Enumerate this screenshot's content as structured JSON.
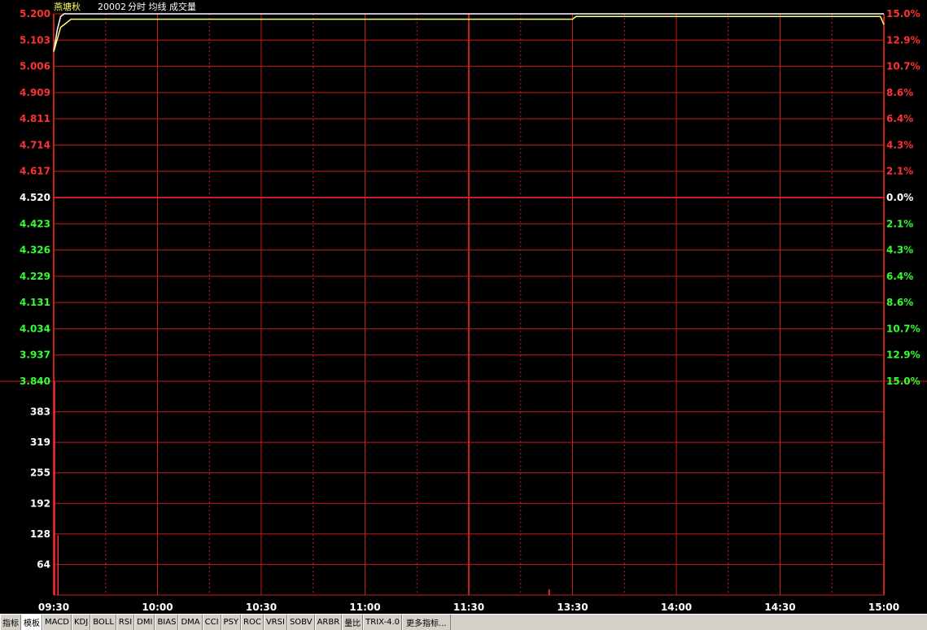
{
  "header": {
    "stock_name": "燕塘秋",
    "code": "20002",
    "legend": "分时 均线 成交量"
  },
  "chart_data": [
    {
      "type": "line",
      "title": "",
      "y_ticks_left": [
        "5.200",
        "5.103",
        "5.006",
        "4.909",
        "4.811",
        "4.714",
        "4.617",
        "4.520",
        "4.423",
        "4.326",
        "4.229",
        "4.131",
        "4.034",
        "3.937",
        "3.840"
      ],
      "y_ticks_right": [
        "15.0%",
        "12.9%",
        "10.7%",
        "8.6%",
        "6.4%",
        "4.3%",
        "2.1%",
        "0.0%",
        "2.1%",
        "4.3%",
        "6.4%",
        "8.6%",
        "10.7%",
        "12.9%",
        "15.0%"
      ],
      "ylim": [
        3.84,
        5.2
      ],
      "prev_close": 4.52,
      "x_ticks": [
        "09:30",
        "10:00",
        "10:30",
        "11:00",
        "11:30",
        "13:30",
        "14:00",
        "14:30",
        "15:00"
      ],
      "series": [
        {
          "name": "分时",
          "color": "#ffffff",
          "points": [
            [
              0,
              5.06
            ],
            [
              1,
              5.14
            ],
            [
              2,
              5.19
            ],
            [
              3,
              5.2
            ],
            [
              240,
              5.2
            ]
          ]
        },
        {
          "name": "均线",
          "color": "#ffff66",
          "points": [
            [
              0,
              5.06
            ],
            [
              2,
              5.15
            ],
            [
              5,
              5.18
            ],
            [
              150,
              5.18
            ],
            [
              151,
              5.19
            ],
            [
              239,
              5.19
            ],
            [
              240,
              5.16
            ]
          ]
        }
      ]
    },
    {
      "type": "bar",
      "y_ticks": [
        "383",
        "319",
        "255",
        "192",
        "128",
        "64"
      ],
      "ylim": [
        0,
        447
      ],
      "bars": [
        {
          "minute": 0,
          "volume": 447
        },
        {
          "minute": 1,
          "volume": 125
        },
        {
          "minute": 143,
          "volume": 12
        }
      ]
    }
  ],
  "colors": {
    "grid": "#c81e1e",
    "up": "#ff3232",
    "down": "#32ff32",
    "flat": "#ffffff",
    "volume": "#ff3232"
  },
  "toolbar": {
    "items": [
      "指标",
      "模板",
      "MACD",
      "KDJ",
      "BOLL",
      "RSI",
      "DMI",
      "BIAS",
      "DMA",
      "CCI",
      "PSY",
      "ROC",
      "VRSI",
      "SOBV",
      "ARBR",
      "量比",
      "TRIX-4.0",
      "更多指标..."
    ],
    "active": "模板"
  }
}
